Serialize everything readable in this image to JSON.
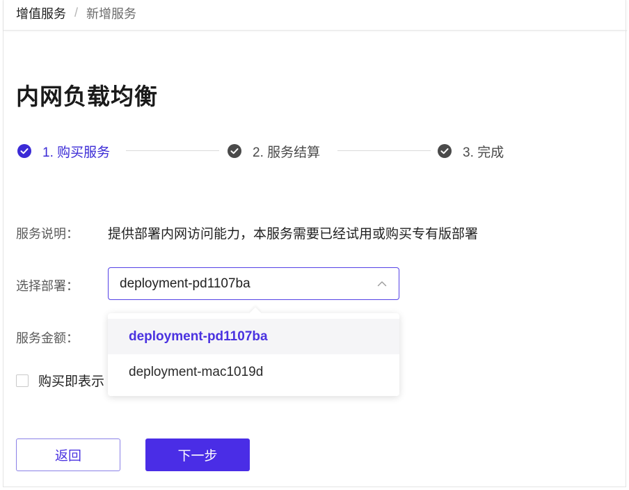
{
  "breadcrumb": {
    "parent": "增值服务",
    "separator": "/",
    "current": "新增服务"
  },
  "page_title": "内网负载均衡",
  "steps": [
    {
      "label": "1. 购买服务",
      "status": "active"
    },
    {
      "label": "2. 服务结算",
      "status": "inactive"
    },
    {
      "label": "3. 完成",
      "status": "inactive"
    }
  ],
  "form": {
    "description_label": "服务说明：",
    "description_value": "提供部署内网访问能力，本服务需要已经试用或购买专有版部署",
    "deployment_label": "选择部署：",
    "deployment_selected": "deployment-pd1107ba",
    "amount_label": "服务金额：",
    "deployment_options": [
      "deployment-pd1107ba",
      "deployment-mac1019d"
    ],
    "agree_label": "购买即表示"
  },
  "buttons": {
    "back": "返回",
    "next": "下一步"
  },
  "colors": {
    "accent": "#4a2de6",
    "step_active": "#3b2bd6",
    "step_inactive": "#4a4a4a",
    "option_selected_bg": "#f5f5f7"
  }
}
